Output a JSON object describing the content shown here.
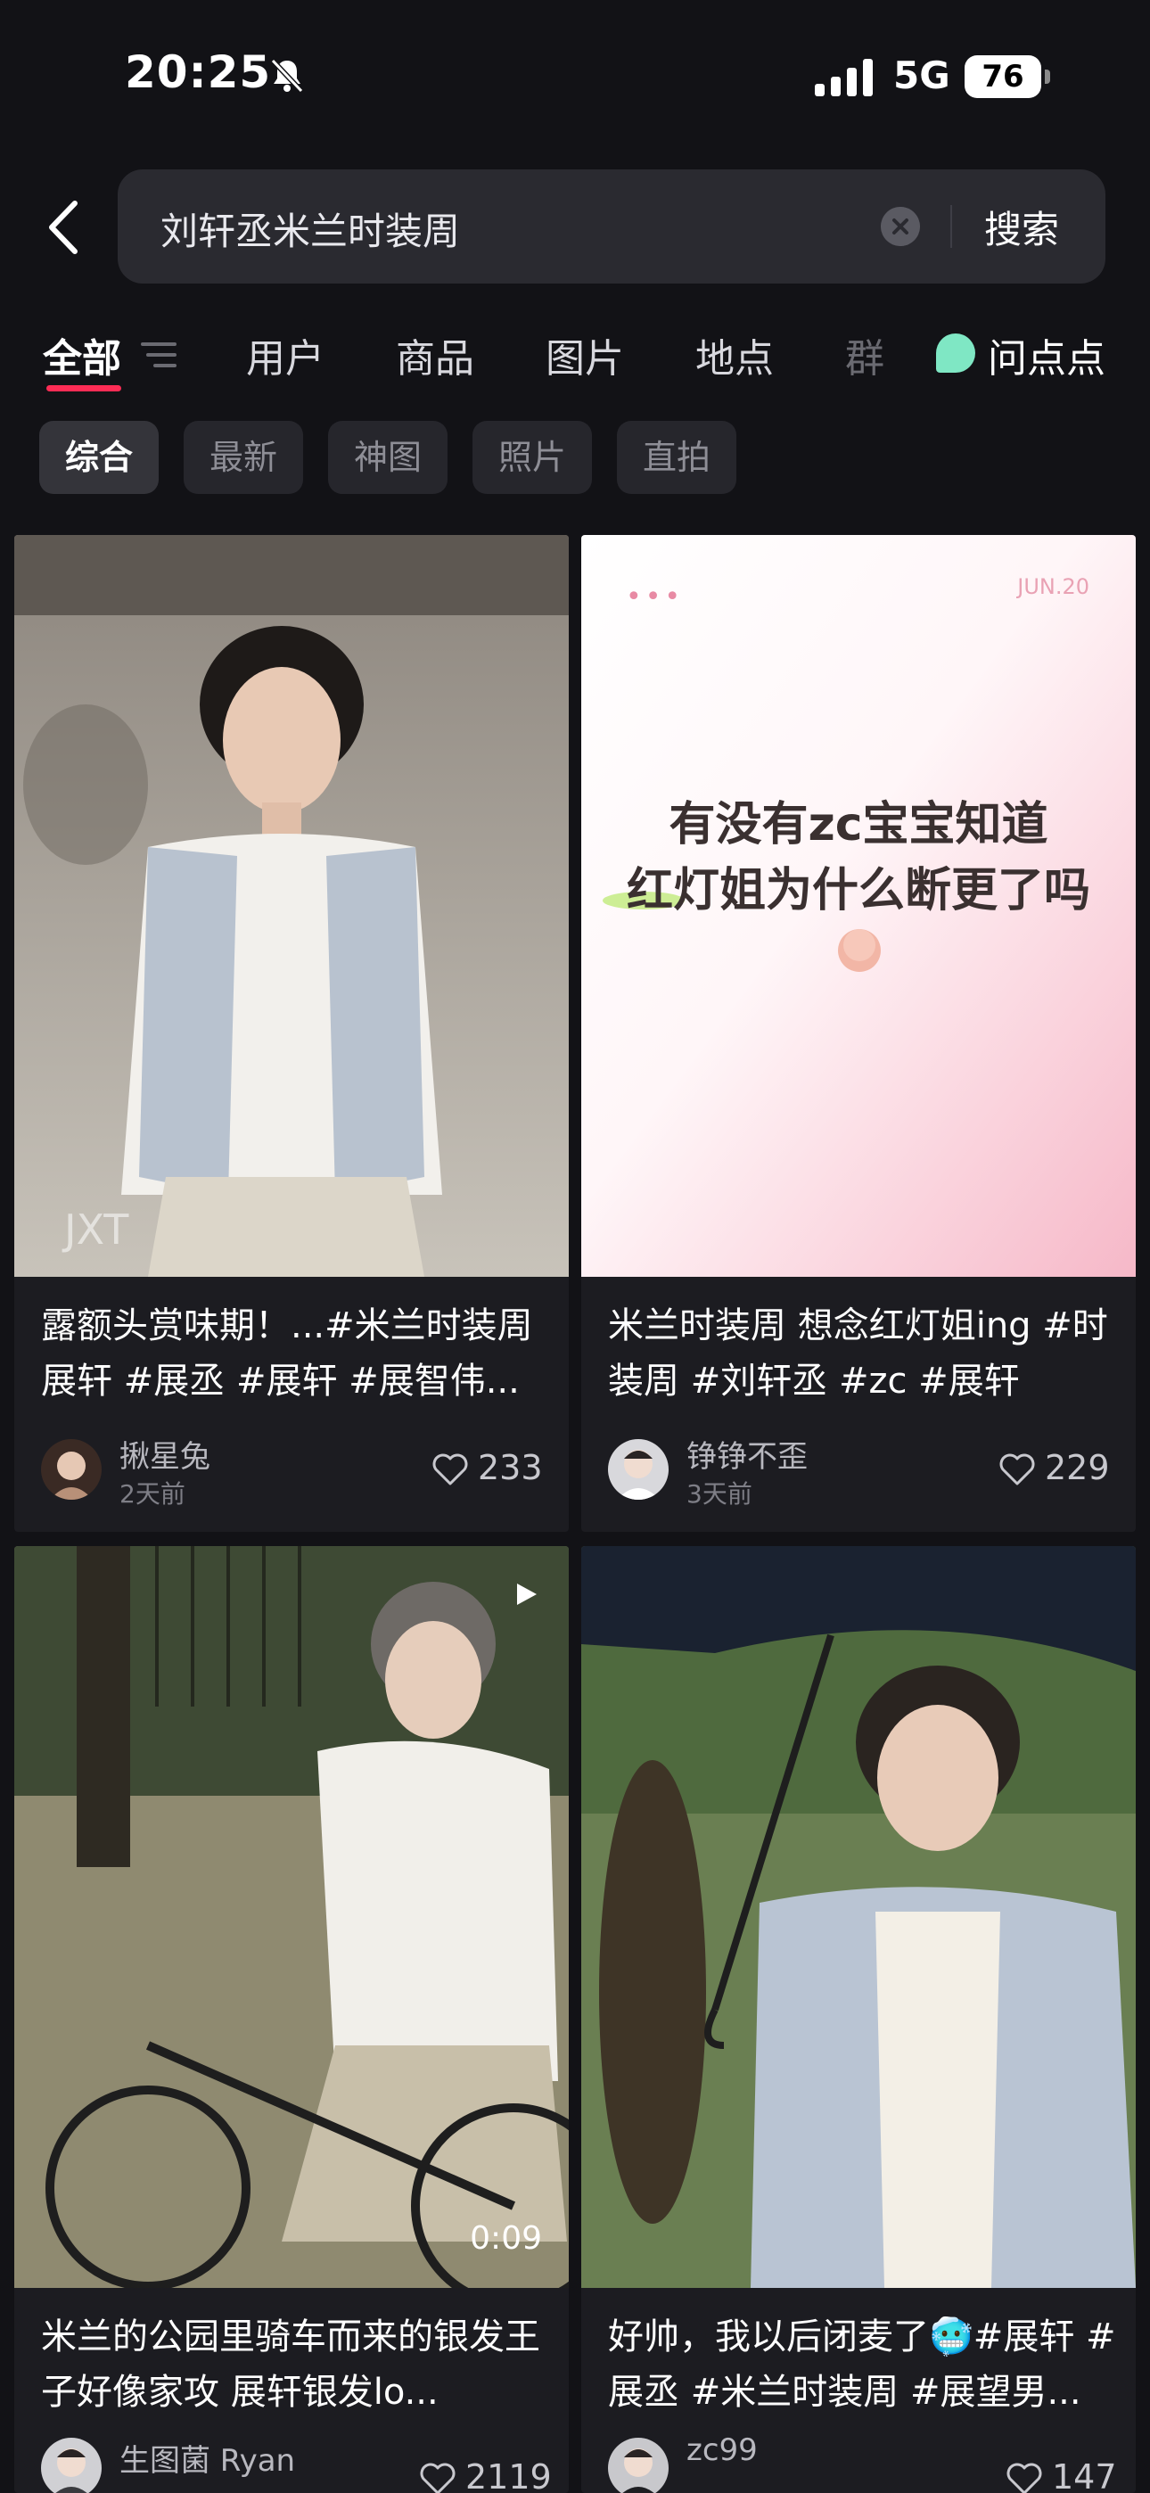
{
  "status_bar": {
    "time": "20:25",
    "network": "5G",
    "battery": "76"
  },
  "search": {
    "query": "刘轩丞米兰时装周",
    "button_label": "搜索"
  },
  "tabs": [
    {
      "label": "全部",
      "active": true
    },
    {
      "label": "用户"
    },
    {
      "label": "商品"
    },
    {
      "label": "图片"
    },
    {
      "label": "地点"
    },
    {
      "label": "群"
    },
    {
      "label": "问点点"
    }
  ],
  "chips": [
    "综合",
    "最新",
    "神图",
    "照片",
    "直拍"
  ],
  "cards": [
    {
      "title": "露额头赏味期！...#米兰时装周 展轩 #展丞 #展轩 #展智伟...",
      "author": "揪星兔",
      "time": "2天前",
      "likes": "233",
      "watermark": "JXT"
    },
    {
      "title": "米兰时装周 想念红灯姐ing #时装周 #刘轩丞 #zc #展轩",
      "author": "铮铮不歪",
      "time": "3天前",
      "likes": "229",
      "poster": {
        "line1": "有没有zc宝宝知道",
        "line2": "红灯姐为什么断更了吗",
        "dots": "•••",
        "date": "JUN.20"
      }
    },
    {
      "title": "米兰的公园里骑车而来的银发王子好像家攻 展轩银发lo...",
      "author": "生图菌 Ryan",
      "likes": "2119",
      "duration": "0:09"
    },
    {
      "title": "好帅，我以后闭麦了🥶#展轩 #展丞 #米兰时装周 #展望男...",
      "author": "zc99",
      "likes": "147"
    }
  ]
}
